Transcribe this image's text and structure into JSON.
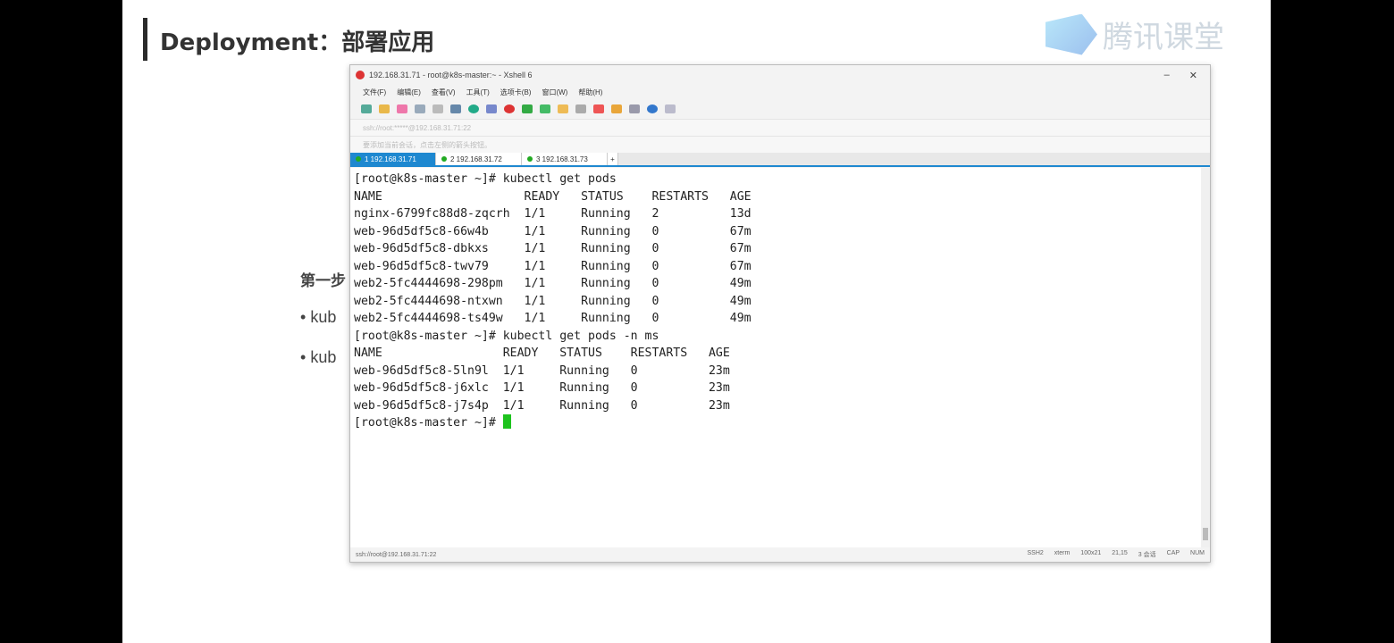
{
  "slide": {
    "title": "Deployment：部署应用",
    "logo_text": "腾讯课堂",
    "step": "第一步",
    "bullets": [
      "kub",
      "kub"
    ]
  },
  "window": {
    "title": "192.168.31.71 - root@k8s-master:~ - Xshell 6",
    "menu": [
      "文件(F)",
      "编辑(E)",
      "查看(V)",
      "工具(T)",
      "选项卡(B)",
      "窗口(W)",
      "帮助(H)"
    ],
    "address": "ssh://root:*****@192.168.31.71:22",
    "hint": "要添加当前会话，点击左侧的箭头按钮。",
    "tabs": [
      "1 192.168.31.71",
      "2 192.168.31.72",
      "3 192.168.31.73"
    ],
    "status_left": "ssh://root@192.168.31.71:22",
    "status_right": [
      "SSH2",
      "xterm",
      "100x21",
      "21,15",
      "3 会话",
      "CAP",
      "NUM"
    ]
  },
  "terminal": {
    "lines": [
      "[root@k8s-master ~]# kubectl get pods",
      "NAME                    READY   STATUS    RESTARTS   AGE",
      "nginx-6799fc88d8-zqcrh  1/1     Running   2          13d",
      "web-96d5df5c8-66w4b     1/1     Running   0          67m",
      "web-96d5df5c8-dbkxs     1/1     Running   0          67m",
      "web-96d5df5c8-twv79     1/1     Running   0          67m",
      "web2-5fc4444698-298pm   1/1     Running   0          49m",
      "web2-5fc4444698-ntxwn   1/1     Running   0          49m",
      "web2-5fc4444698-ts49w   1/1     Running   0          49m",
      "[root@k8s-master ~]# kubectl get pods -n ms",
      "NAME                 READY   STATUS    RESTARTS   AGE",
      "web-96d5df5c8-5ln9l  1/1     Running   0          23m",
      "web-96d5df5c8-j6xlc  1/1     Running   0          23m",
      "web-96d5df5c8-j7s4p  1/1     Running   0          23m"
    ],
    "prompt": "[root@k8s-master ~]# "
  },
  "colors": {
    "tab_active": "#1e88d0",
    "cursor": "#1ec31e"
  }
}
